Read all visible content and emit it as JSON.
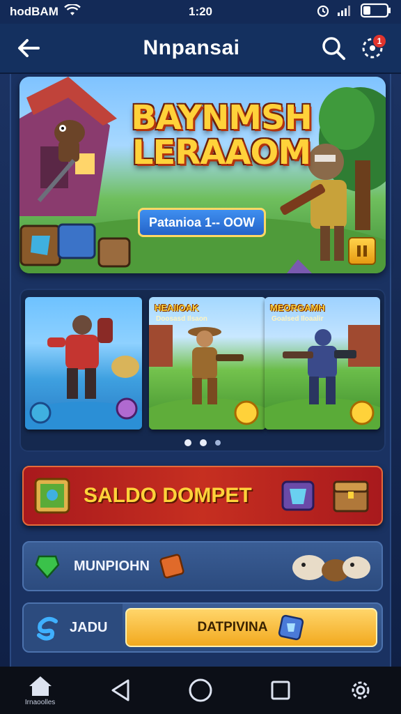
{
  "status_bar": {
    "carrier": "hodBAM",
    "time": "1:20"
  },
  "header": {
    "title": "Nnpansai",
    "notification_count": "1"
  },
  "hero": {
    "title_line1": "BAYNMSH",
    "title_line2": "LERAAOM",
    "cta_label": "Patanioa 1-- OOW"
  },
  "carousel": {
    "cards": [
      {
        "label": "",
        "sub": ""
      },
      {
        "label": "HEAIIOAK",
        "sub": "Doosasd   Ilsaon"
      },
      {
        "label": "MEORGAMH",
        "sub": "Goalsed   Iloaalir"
      }
    ],
    "active_index": 1
  },
  "wallet": {
    "label": "SALDO DOMPET"
  },
  "rows": {
    "row1_label": "MUNPIOHN",
    "row2_left_label": "JADU",
    "row2_button_label": "DATPIVINA"
  },
  "bottom_nav": {
    "home_label": "Irnaoolles"
  },
  "colors": {
    "accent_yellow": "#ffd23a",
    "wallet_red": "#c62f20",
    "header_blue": "#14305f"
  }
}
